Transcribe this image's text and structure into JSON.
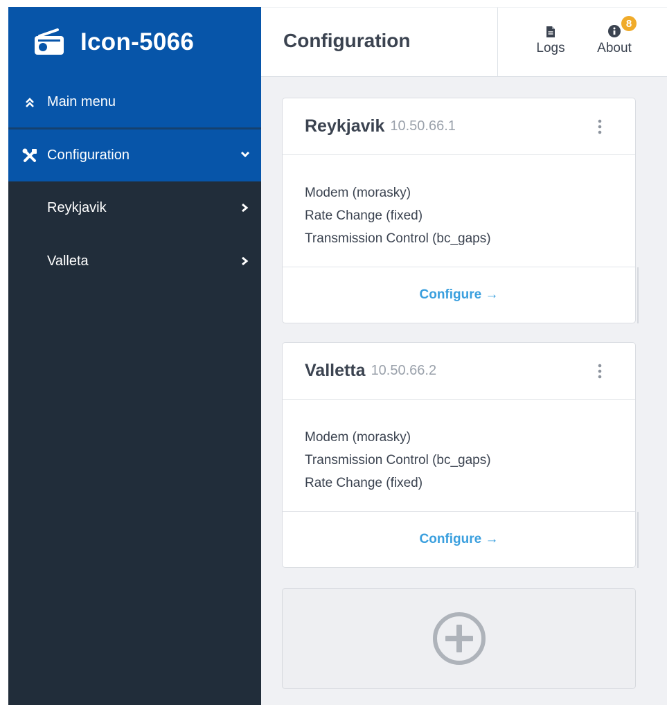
{
  "app": {
    "title": "Icon-5066"
  },
  "sidebar": {
    "main_menu": "Main menu",
    "configuration": "Configuration",
    "items": [
      {
        "label": "Reykjavik"
      },
      {
        "label": "Valleta"
      }
    ]
  },
  "header": {
    "title": "Configuration",
    "logs_label": "Logs",
    "about_label": "About",
    "about_badge": "8"
  },
  "cards": [
    {
      "name": "Reykjavik",
      "ip": "10.50.66.1",
      "modules": [
        "Modem (morasky)",
        "Rate Change (fixed)",
        "Transmission Control (bc_gaps)"
      ],
      "action": "Configure →"
    },
    {
      "name": "Valletta",
      "ip": "10.50.66.2",
      "modules": [
        "Modem (morasky)",
        "Transmission Control (bc_gaps)",
        "Rate Change (fixed)"
      ],
      "action": "Configure →"
    }
  ],
  "colors": {
    "brand": "#0755a9",
    "sidebar": "#212d3a",
    "link": "#3a9fde",
    "badge": "#f0ab2a"
  },
  "icons": [
    "radio-icon",
    "double-chevron-up-icon",
    "tools-icon",
    "chevron-down-icon",
    "chevron-right-icon",
    "file-icon",
    "info-icon",
    "kebab-menu-icon",
    "plus-circle-icon"
  ]
}
